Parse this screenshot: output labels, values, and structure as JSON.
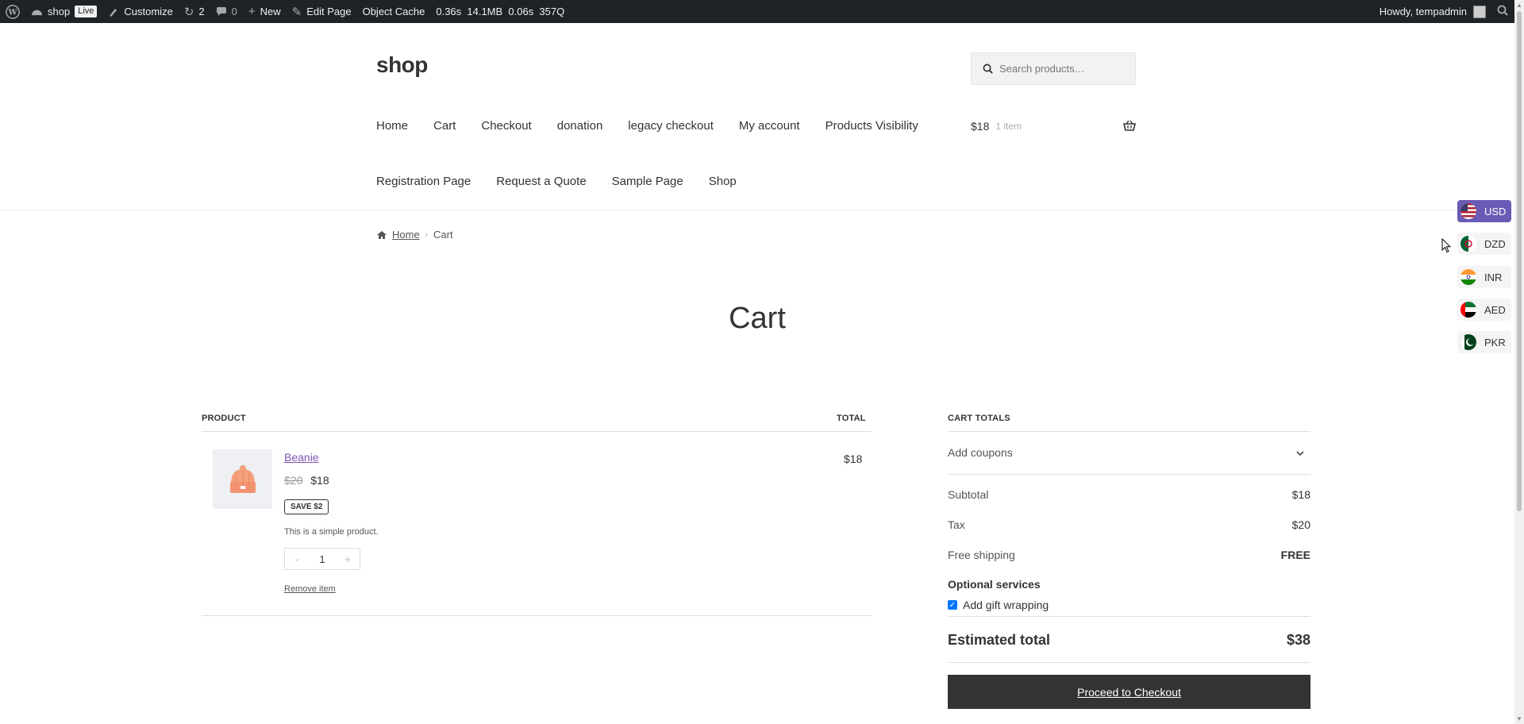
{
  "admin_bar": {
    "site": "shop",
    "live": "Live",
    "customize": "Customize",
    "updates": "2",
    "comments": "0",
    "new": "New",
    "edit_page": "Edit Page",
    "object_cache": "Object Cache",
    "stats": "0.36s  14.1MB  0.06s  357Q",
    "howdy": "Howdy, tempadmin"
  },
  "header": {
    "site_title": "shop",
    "search_placeholder": "Search products…",
    "nav_row1": [
      "Home",
      "Cart",
      "Checkout",
      "donation",
      "legacy checkout",
      "My account",
      "Products Visibility"
    ],
    "nav_row2": [
      "Registration Page",
      "Request a Quote",
      "Sample Page",
      "Shop"
    ],
    "mini_cart_amount": "$18",
    "mini_cart_count": "1 item"
  },
  "breadcrumb": {
    "home": "Home",
    "current": "Cart"
  },
  "page_title": "Cart",
  "cart": {
    "product_header": "PRODUCT",
    "total_header": "TOTAL",
    "item": {
      "name": "Beanie",
      "old_price": "$20",
      "price": "$18",
      "save_badge": "SAVE $2",
      "description": "This is a simple product.",
      "qty_minus": "-",
      "quantity": "1",
      "qty_plus": "+",
      "remove": "Remove item",
      "line_total": "$18"
    }
  },
  "totals": {
    "heading": "CART TOTALS",
    "add_coupons": "Add coupons",
    "subtotal_label": "Subtotal",
    "subtotal_value": "$18",
    "tax_label": "Tax",
    "tax_value": "$20",
    "shipping_label": "Free shipping",
    "shipping_value": "FREE",
    "optional_title": "Optional services",
    "gift_label": "Add gift wrapping",
    "gift_checked": true,
    "estimated_label": "Estimated total",
    "estimated_value": "$38",
    "checkout_button": "Proceed to Checkout"
  },
  "currencies": [
    {
      "code": "USD",
      "active": true
    },
    {
      "code": "DZD",
      "active": false
    },
    {
      "code": "INR",
      "active": false
    },
    {
      "code": "AED",
      "active": false
    },
    {
      "code": "PKR",
      "active": false
    }
  ],
  "colors": {
    "admin_bar_bg": "#1d2327",
    "accent_purple": "#6b5bb5",
    "link_purple": "#7f54b3",
    "button_dark": "#333333",
    "checkbox_blue": "#0075ff"
  }
}
